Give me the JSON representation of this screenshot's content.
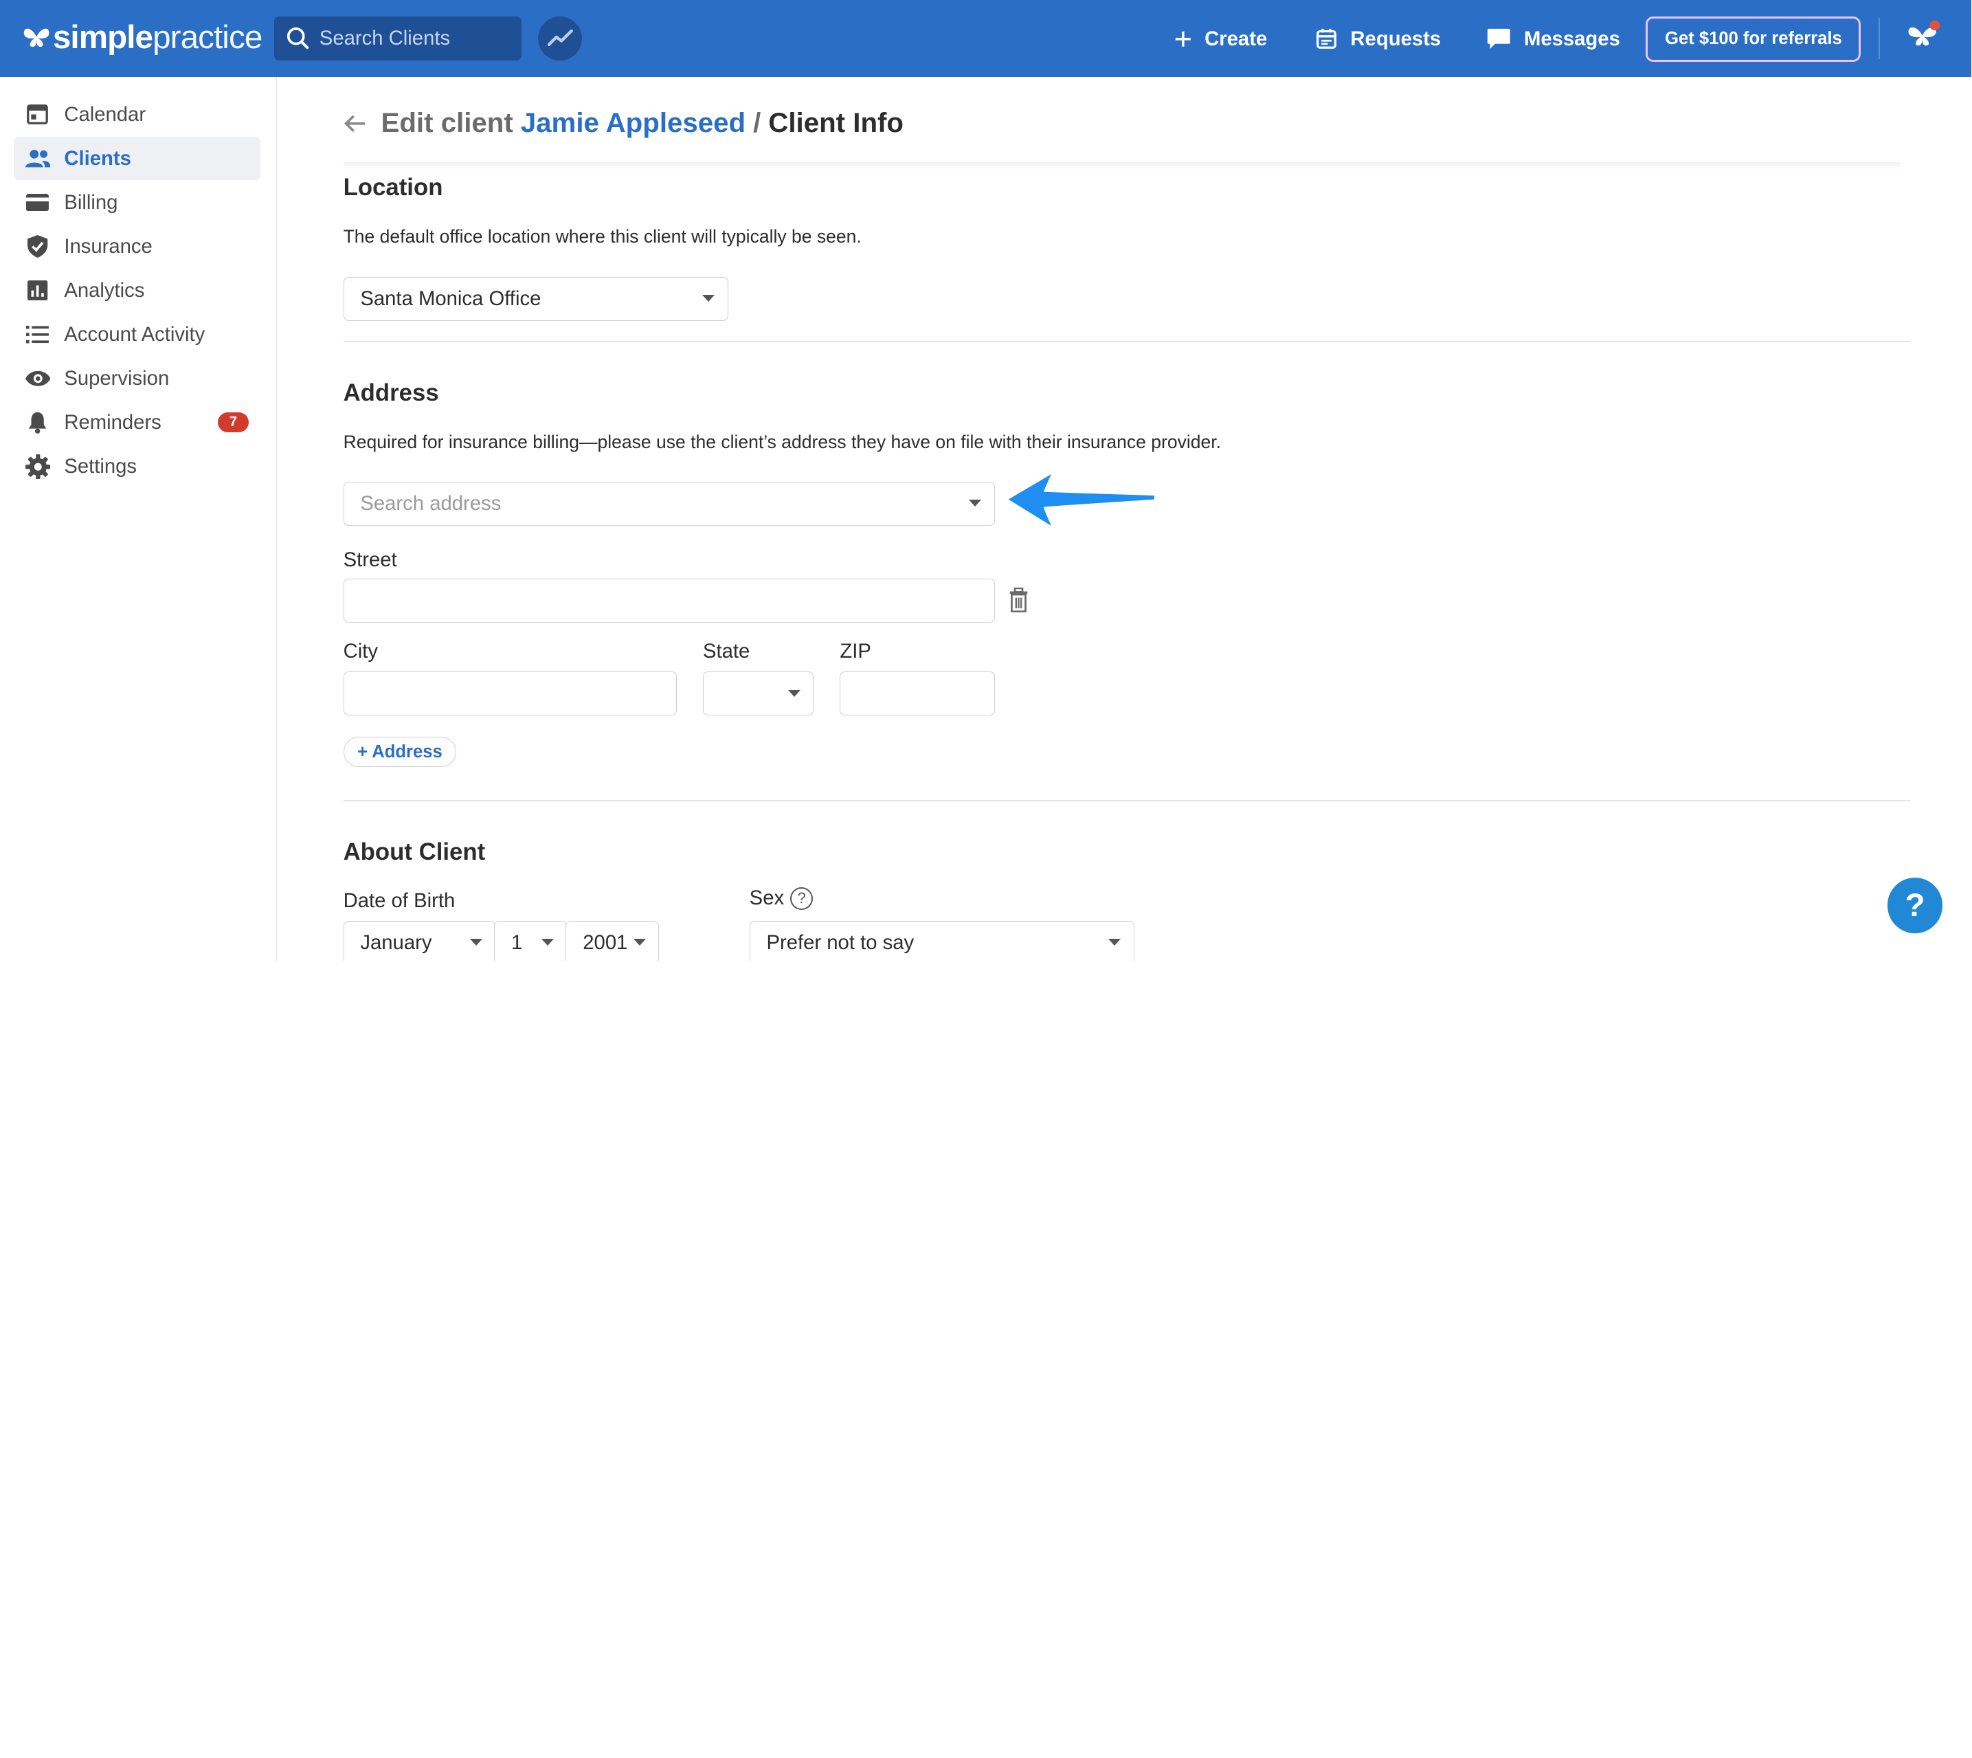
{
  "app": {
    "logo_bold": "simple",
    "logo_light": "practice"
  },
  "topbar": {
    "search_placeholder": "Search Clients",
    "create_label": "Create",
    "requests_label": "Requests",
    "messages_label": "Messages",
    "referral_label": "Get $100 for referrals"
  },
  "sidebar": {
    "items": [
      {
        "label": "Calendar",
        "icon": "calendar-icon"
      },
      {
        "label": "Clients",
        "icon": "clients-icon",
        "active": true
      },
      {
        "label": "Billing",
        "icon": "billing-card-icon"
      },
      {
        "label": "Insurance",
        "icon": "shield-check-icon"
      },
      {
        "label": "Analytics",
        "icon": "bar-chart-icon"
      },
      {
        "label": "Account Activity",
        "icon": "list-icon"
      },
      {
        "label": "Supervision",
        "icon": "eye-icon"
      },
      {
        "label": "Reminders",
        "icon": "bell-icon",
        "badge": "7"
      },
      {
        "label": "Settings",
        "icon": "gear-icon"
      }
    ]
  },
  "header": {
    "prefix": "Edit client",
    "client_name": "Jamie Appleseed",
    "separator": "/",
    "current": "Client Info"
  },
  "location": {
    "title": "Location",
    "description": "The default office location where this client will typically be seen.",
    "selected": "Santa Monica Office"
  },
  "address": {
    "title": "Address",
    "description": "Required for insurance billing—please use the client’s address they have on file with their insurance provider.",
    "search_placeholder": "Search address",
    "street_label": "Street",
    "city_label": "City",
    "state_label": "State",
    "zip_label": "ZIP",
    "add_label": "+ Address"
  },
  "about": {
    "title": "About Client",
    "dob_label": "Date of Birth",
    "dob_month": "January",
    "dob_day": "1",
    "dob_year": "2001",
    "sex_label": "Sex",
    "sex_value": "Prefer not to say",
    "help_glyph": "?"
  },
  "help_fab": "?",
  "colors": {
    "brand": "#2a6ec6",
    "arrow": "#1e8ff0",
    "badge": "#d23b2b"
  }
}
